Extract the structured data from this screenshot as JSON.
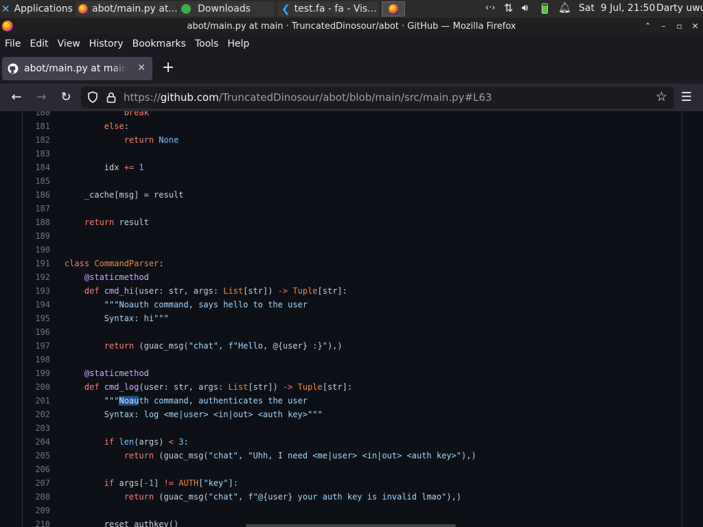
{
  "panel": {
    "tasks": [
      {
        "label": "Applications",
        "icon": "applications-icon"
      },
      {
        "label": "abot/main.py at...",
        "icon": "firefox-icon"
      },
      {
        "label": "Downloads",
        "icon": "downloads-icon"
      },
      {
        "label": "test.fa - fa - Vis...",
        "icon": "vscode-icon"
      },
      {
        "label": "",
        "icon": "firefox-icon"
      }
    ],
    "clock": "Sat  9 Jul, 21:50",
    "user": "Darty uwu",
    "tray_icons": [
      "network-switch-icon",
      "network-transfer-icon",
      "volume-icon",
      "battery-icon",
      "notification-bell-icon"
    ]
  },
  "window": {
    "title": "abot/main.py at main · TruncatedDinosour/abot · GitHub — Mozilla Firefox",
    "controls": [
      "minimize-icon",
      "maximize-icon",
      "close-icon"
    ]
  },
  "menu": [
    "File",
    "Edit",
    "View",
    "History",
    "Bookmarks",
    "Tools",
    "Help"
  ],
  "tab": {
    "label": "abot/main.py at main · TruncatedDinosour/abot",
    "close": "✕"
  },
  "newtab": "+",
  "url": {
    "prefix": "https://",
    "host": "github.com",
    "path": "/TruncatedDinosour/abot/blob/main/src/main.py#L63"
  },
  "code": {
    "lines": [
      {
        "n": "180",
        "i": 3,
        "t": [
          {
            "s": "break",
            "c": "kw"
          }
        ]
      },
      {
        "n": "181",
        "i": 2,
        "t": [
          {
            "s": "else",
            "c": "kw"
          },
          {
            "s": ":",
            "c": ""
          }
        ]
      },
      {
        "n": "182",
        "i": 3,
        "t": [
          {
            "s": "return ",
            "c": "kw"
          },
          {
            "s": "None",
            "c": "cst"
          }
        ]
      },
      {
        "n": "183",
        "i": 0,
        "t": []
      },
      {
        "n": "184",
        "i": 2,
        "t": [
          {
            "s": "idx ",
            "c": ""
          },
          {
            "s": "+=",
            "c": "kw"
          },
          {
            "s": " ",
            "c": ""
          },
          {
            "s": "1",
            "c": "cst"
          }
        ]
      },
      {
        "n": "185",
        "i": 0,
        "t": []
      },
      {
        "n": "186",
        "i": 1,
        "t": [
          {
            "s": "_cache[msg] = result",
            "c": ""
          }
        ]
      },
      {
        "n": "187",
        "i": 0,
        "t": []
      },
      {
        "n": "188",
        "i": 1,
        "t": [
          {
            "s": "return ",
            "c": "kw"
          },
          {
            "s": "result",
            "c": ""
          }
        ]
      },
      {
        "n": "189",
        "i": 0,
        "t": []
      },
      {
        "n": "190",
        "i": 0,
        "t": []
      },
      {
        "n": "191",
        "i": 0,
        "t": [
          {
            "s": "class ",
            "c": "kw"
          },
          {
            "s": "CommandParser",
            "c": "cls"
          },
          {
            "s": ":",
            "c": ""
          }
        ]
      },
      {
        "n": "192",
        "i": 1,
        "t": [
          {
            "s": "@staticmethod",
            "c": "dec"
          }
        ]
      },
      {
        "n": "193",
        "i": 1,
        "t": [
          {
            "s": "def ",
            "c": "kw"
          },
          {
            "s": "cmd_hi",
            "c": "fn"
          },
          {
            "s": "(user: str, args: ",
            "c": ""
          },
          {
            "s": "List",
            "c": "cls"
          },
          {
            "s": "[str]) ",
            "c": ""
          },
          {
            "s": "->",
            "c": "kw"
          },
          {
            "s": " ",
            "c": ""
          },
          {
            "s": "Tuple",
            "c": "cls"
          },
          {
            "s": "[str]:",
            "c": ""
          }
        ]
      },
      {
        "n": "194",
        "i": 2,
        "t": [
          {
            "s": "\"\"\"Noauth command, says hello to the user",
            "c": "str"
          }
        ]
      },
      {
        "n": "195",
        "i": 2,
        "t": [
          {
            "s": "Syntax: hi\"\"\"",
            "c": "str"
          }
        ]
      },
      {
        "n": "196",
        "i": 0,
        "t": []
      },
      {
        "n": "197",
        "i": 2,
        "t": [
          {
            "s": "return ",
            "c": "kw"
          },
          {
            "s": "(guac_msg(",
            "c": ""
          },
          {
            "s": "\"chat\"",
            "c": "str"
          },
          {
            "s": ", ",
            "c": ""
          },
          {
            "s": "f\"Hello, @",
            "c": "str"
          },
          {
            "s": "{user}",
            "c": ""
          },
          {
            "s": " :}\"",
            "c": "str"
          },
          {
            "s": "),)",
            "c": ""
          }
        ]
      },
      {
        "n": "198",
        "i": 0,
        "t": []
      },
      {
        "n": "199",
        "i": 1,
        "t": [
          {
            "s": "@staticmethod",
            "c": "dec"
          }
        ]
      },
      {
        "n": "200",
        "i": 1,
        "t": [
          {
            "s": "def ",
            "c": "kw"
          },
          {
            "s": "cmd_log",
            "c": "fn"
          },
          {
            "s": "(user: str, args: ",
            "c": ""
          },
          {
            "s": "List",
            "c": "cls"
          },
          {
            "s": "[str]) ",
            "c": ""
          },
          {
            "s": "->",
            "c": "kw"
          },
          {
            "s": " ",
            "c": ""
          },
          {
            "s": "Tuple",
            "c": "cls"
          },
          {
            "s": "[str]:",
            "c": ""
          }
        ]
      },
      {
        "n": "201",
        "i": 2,
        "t": [
          {
            "s": "\"\"\"",
            "c": "str"
          },
          {
            "s": "Noau",
            "c": "hl"
          },
          {
            "s": "th command, authenticates the user",
            "c": "str"
          }
        ]
      },
      {
        "n": "202",
        "i": 2,
        "t": [
          {
            "s": "Syntax: log <me|user> <in|out> <auth key>\"\"\"",
            "c": "str"
          }
        ]
      },
      {
        "n": "203",
        "i": 0,
        "t": []
      },
      {
        "n": "204",
        "i": 2,
        "t": [
          {
            "s": "if ",
            "c": "kw"
          },
          {
            "s": "len",
            "c": "cst"
          },
          {
            "s": "(args) ",
            "c": ""
          },
          {
            "s": "<",
            "c": "kw"
          },
          {
            "s": " ",
            "c": ""
          },
          {
            "s": "3",
            "c": "cst"
          },
          {
            "s": ":",
            "c": ""
          }
        ]
      },
      {
        "n": "205",
        "i": 3,
        "t": [
          {
            "s": "return ",
            "c": "kw"
          },
          {
            "s": "(guac_msg(",
            "c": ""
          },
          {
            "s": "\"chat\"",
            "c": "str"
          },
          {
            "s": ", ",
            "c": ""
          },
          {
            "s": "\"Uhh, I need <me|user> <in|out> <auth key>\"",
            "c": "str"
          },
          {
            "s": "),)",
            "c": ""
          }
        ]
      },
      {
        "n": "206",
        "i": 0,
        "t": []
      },
      {
        "n": "207",
        "i": 2,
        "t": [
          {
            "s": "if ",
            "c": "kw"
          },
          {
            "s": "args[",
            "c": ""
          },
          {
            "s": "-1",
            "c": "cst"
          },
          {
            "s": "] ",
            "c": ""
          },
          {
            "s": "!=",
            "c": "kw"
          },
          {
            "s": " ",
            "c": ""
          },
          {
            "s": "AUTH",
            "c": "cls"
          },
          {
            "s": "[",
            "c": ""
          },
          {
            "s": "\"key\"",
            "c": "str"
          },
          {
            "s": "]:",
            "c": ""
          }
        ]
      },
      {
        "n": "208",
        "i": 3,
        "t": [
          {
            "s": "return ",
            "c": "kw"
          },
          {
            "s": "(guac_msg(",
            "c": ""
          },
          {
            "s": "\"chat\"",
            "c": "str"
          },
          {
            "s": ", ",
            "c": ""
          },
          {
            "s": "f\"@",
            "c": "str"
          },
          {
            "s": "{user}",
            "c": ""
          },
          {
            "s": " your auth key is invalid lmao\"",
            "c": "str"
          },
          {
            "s": "),)",
            "c": ""
          }
        ]
      },
      {
        "n": "209",
        "i": 0,
        "t": []
      },
      {
        "n": "210",
        "i": 2,
        "t": [
          {
            "s": "reset_authkey()",
            "c": ""
          }
        ]
      }
    ]
  }
}
